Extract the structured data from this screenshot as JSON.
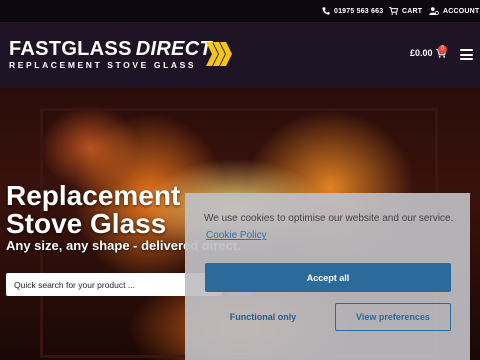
{
  "topbar": {
    "phone": "01975 563 663",
    "cart_label": "CART",
    "account_label": "ACCOUNT"
  },
  "header": {
    "logo_main": "FASTGLASS",
    "logo_direct": "DIRECT",
    "logo_tagline": "REPLACEMENT STOVE GLASS",
    "cart_total": "£0.00",
    "cart_count": "0"
  },
  "hero": {
    "title_line1": "Replacement",
    "title_line2": "Stove Glass",
    "subtitle": "Any size, any shape - delivered direct.",
    "search_placeholder": "Quick search for your product ..."
  },
  "cookie": {
    "message": "We use cookies to optimise our website and our service.",
    "policy_link": "Cookie Policy",
    "accept_label": "Accept all",
    "functional_label": "Functional only",
    "preferences_label": "View preferences"
  },
  "colors": {
    "accent_blue": "#2c6a9c",
    "logo_yellow": "#f5c518",
    "badge_red": "#e24a3b",
    "header_bg": "#1f1426"
  },
  "icons": [
    "phone-icon",
    "cart-icon",
    "account-icon",
    "chevrons-logo-icon",
    "menu-icon",
    "search-icon"
  ]
}
